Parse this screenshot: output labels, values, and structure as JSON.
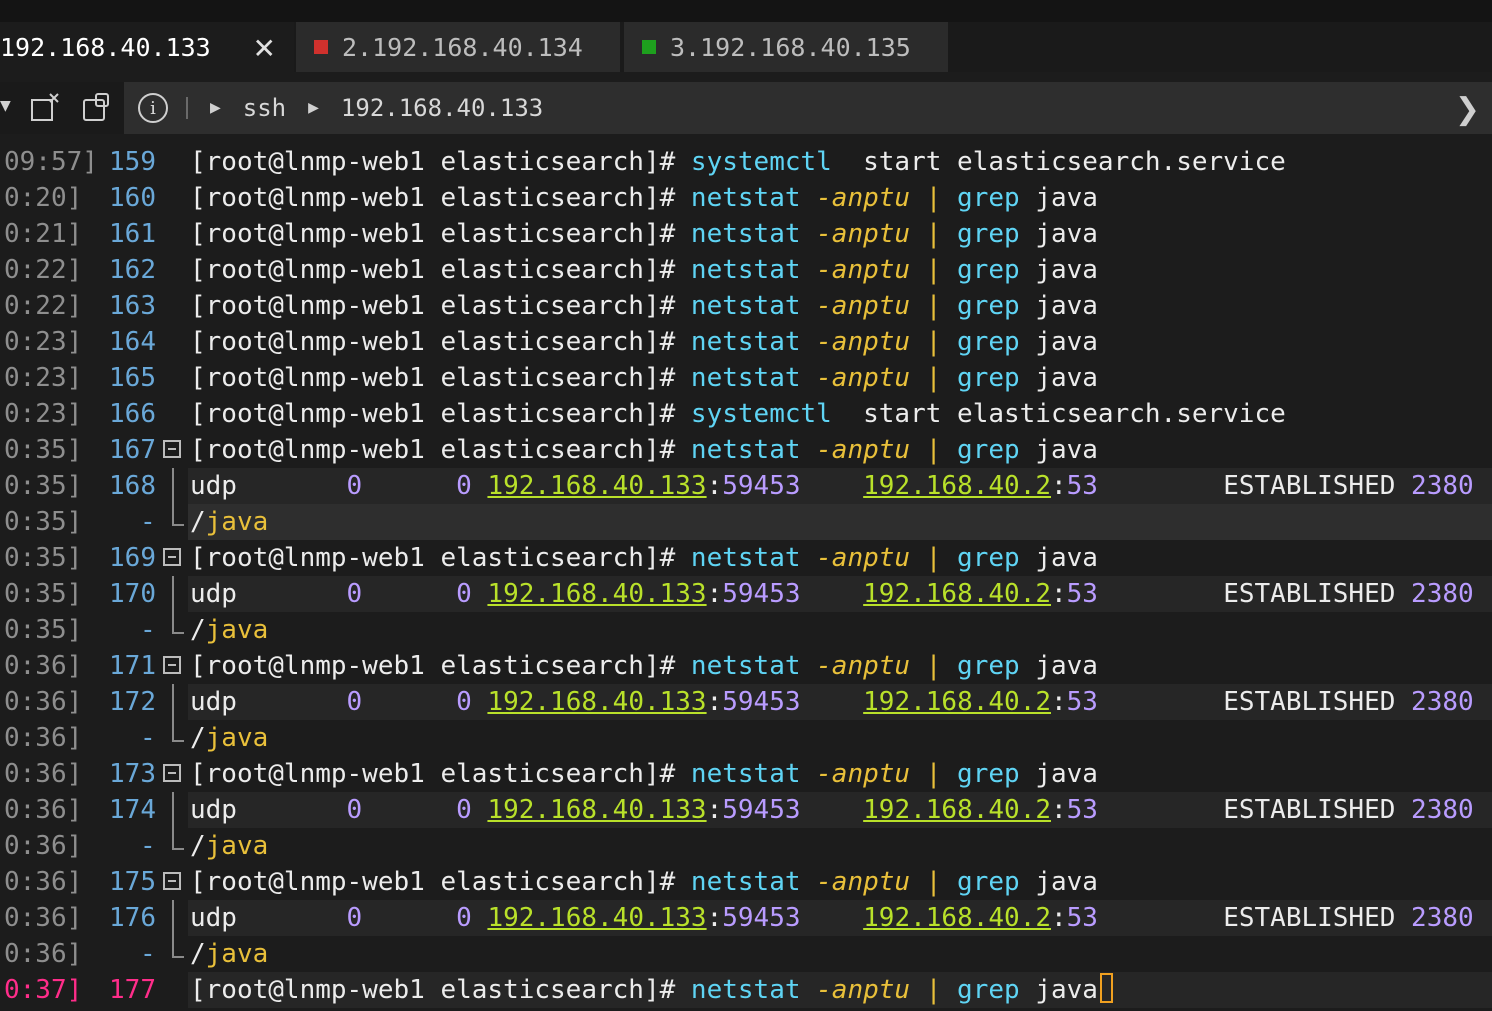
{
  "tabs": [
    {
      "label": "192.168.40.133",
      "close": "✕"
    },
    {
      "label": "2.192.168.40.134",
      "color": "#d0312d"
    },
    {
      "label": "3.192.168.40.135",
      "color": "#1ea01e"
    }
  ],
  "breadcrumb": {
    "protocol": "ssh",
    "host": "192.168.40.133"
  },
  "prompt": "[root@lnmp-web1 elasticsearch]#",
  "lines": [
    {
      "ts": "09:57]",
      "ln": "159",
      "kind": "cmd",
      "cmd": "systemctl",
      "args": "start elasticsearch.service"
    },
    {
      "ts": "0:20]",
      "ln": "160",
      "kind": "net"
    },
    {
      "ts": "0:21]",
      "ln": "161",
      "kind": "net"
    },
    {
      "ts": "0:22]",
      "ln": "162",
      "kind": "net"
    },
    {
      "ts": "0:22]",
      "ln": "163",
      "kind": "net"
    },
    {
      "ts": "0:23]",
      "ln": "164",
      "kind": "net"
    },
    {
      "ts": "0:23]",
      "ln": "165",
      "kind": "net"
    },
    {
      "ts": "0:23]",
      "ln": "166",
      "kind": "cmd",
      "cmd": "systemctl",
      "args": "start elasticsearch.service"
    },
    {
      "ts": "0:35]",
      "ln": "167",
      "kind": "net",
      "fold": true
    },
    {
      "ts": "0:35]",
      "ln": "168",
      "kind": "udp"
    },
    {
      "ts": "0:35]",
      "ln": "-",
      "kind": "java"
    },
    {
      "ts": "0:35]",
      "ln": "169",
      "kind": "net",
      "fold": true
    },
    {
      "ts": "0:35]",
      "ln": "170",
      "kind": "udp"
    },
    {
      "ts": "0:35]",
      "ln": "-",
      "kind": "java"
    },
    {
      "ts": "0:36]",
      "ln": "171",
      "kind": "net",
      "fold": true
    },
    {
      "ts": "0:36]",
      "ln": "172",
      "kind": "udp"
    },
    {
      "ts": "0:36]",
      "ln": "-",
      "kind": "java"
    },
    {
      "ts": "0:36]",
      "ln": "173",
      "kind": "net",
      "fold": true
    },
    {
      "ts": "0:36]",
      "ln": "174",
      "kind": "udp"
    },
    {
      "ts": "0:36]",
      "ln": "-",
      "kind": "java"
    },
    {
      "ts": "0:36]",
      "ln": "175",
      "kind": "net",
      "fold": true
    },
    {
      "ts": "0:36]",
      "ln": "176",
      "kind": "udp"
    },
    {
      "ts": "0:36]",
      "ln": "-",
      "kind": "java"
    },
    {
      "ts": "0:37]",
      "ln": "177",
      "kind": "net",
      "current": true
    }
  ],
  "netstat": {
    "cmd": "netstat",
    "opt": "-anptu",
    "pipe": "|",
    "grep": "grep",
    "word": "java"
  },
  "udp": {
    "proto": "udp",
    "recv": "0",
    "send": "0",
    "local_ip": "192.168.40.133",
    "local_port": "59453",
    "foreign_ip": "192.168.40.2",
    "foreign_port": "53",
    "state": "ESTABLISHED",
    "pid": "2380"
  },
  "java_line": {
    "slash": "/",
    "name": "java"
  }
}
